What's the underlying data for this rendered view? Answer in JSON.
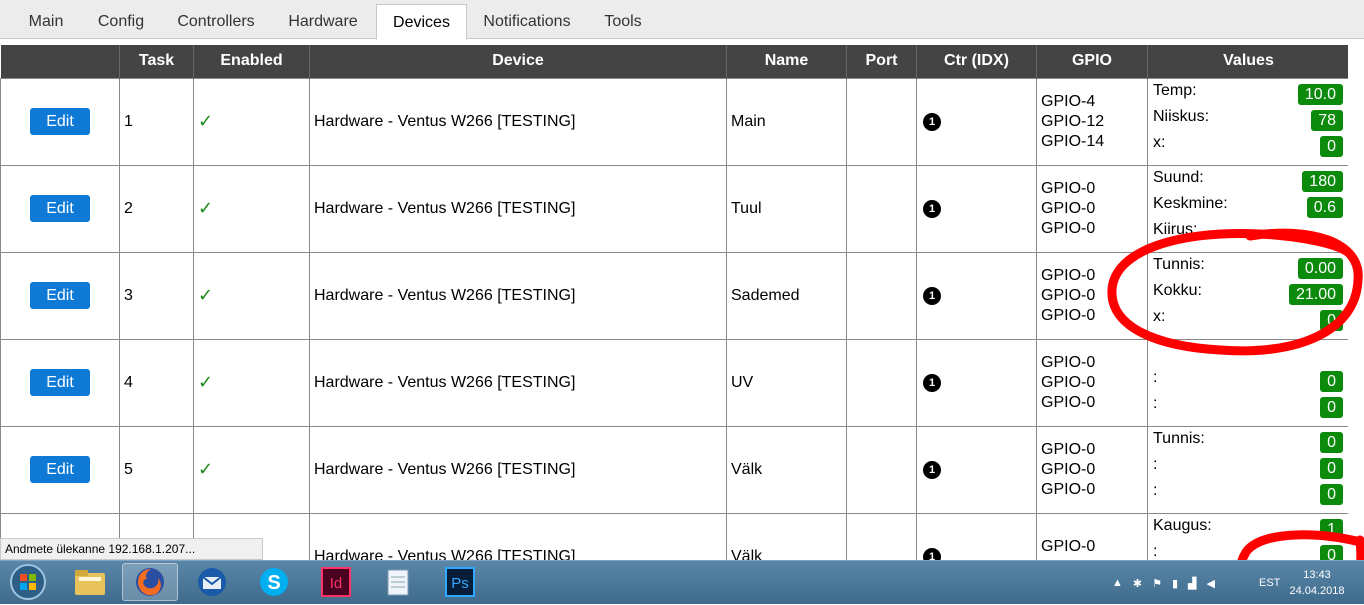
{
  "tabs": [
    {
      "label": "Main",
      "active": false
    },
    {
      "label": "Config",
      "active": false
    },
    {
      "label": "Controllers",
      "active": false
    },
    {
      "label": "Hardware",
      "active": false
    },
    {
      "label": "Devices",
      "active": true
    },
    {
      "label": "Notifications",
      "active": false
    },
    {
      "label": "Tools",
      "active": false
    }
  ],
  "table": {
    "headers": [
      "",
      "Task",
      "Enabled",
      "Device",
      "Name",
      "Port",
      "Ctr (IDX)",
      "GPIO",
      "Values"
    ],
    "edit_label": "Edit",
    "check_glyph": "✓",
    "ctr_glyph": "1",
    "rows": [
      {
        "task": "1",
        "device": "Hardware - Ventus W266 [TESTING]",
        "name": "Main",
        "port": "",
        "gpio": [
          "GPIO-4",
          "GPIO-12",
          "GPIO-14"
        ],
        "values": [
          {
            "label": "Temp:",
            "value": "10.0"
          },
          {
            "label": "Niiskus:",
            "value": "78"
          },
          {
            "label": "x:",
            "value": "0"
          }
        ]
      },
      {
        "task": "2",
        "device": "Hardware - Ventus W266 [TESTING]",
        "name": "Tuul",
        "port": "",
        "gpio": [
          "GPIO-0",
          "GPIO-0",
          "GPIO-0"
        ],
        "values": [
          {
            "label": "Suund:",
            "value": "180"
          },
          {
            "label": "Keskmine:",
            "value": "0.6"
          },
          {
            "label": "Kiirus:",
            "value": ""
          }
        ]
      },
      {
        "task": "3",
        "device": "Hardware - Ventus W266 [TESTING]",
        "name": "Sademed",
        "port": "",
        "gpio": [
          "GPIO-0",
          "GPIO-0",
          "GPIO-0"
        ],
        "values": [
          {
            "label": "Tunnis:",
            "value": "0.00"
          },
          {
            "label": "Kokku:",
            "value": "21.00"
          },
          {
            "label": "x:",
            "value": "0"
          }
        ]
      },
      {
        "task": "4",
        "device": "Hardware - Ventus W266 [TESTING]",
        "name": "UV",
        "port": "",
        "gpio": [
          "GPIO-0",
          "GPIO-0",
          "GPIO-0"
        ],
        "values": [
          {
            "label": "",
            "value": ""
          },
          {
            "label": ":",
            "value": "0"
          },
          {
            "label": ":",
            "value": "0"
          }
        ]
      },
      {
        "task": "5",
        "device": "Hardware - Ventus W266 [TESTING]",
        "name": "Välk",
        "port": "",
        "gpio": [
          "GPIO-0",
          "GPIO-0",
          "GPIO-0"
        ],
        "values": [
          {
            "label": "Tunnis:",
            "value": "0"
          },
          {
            "label": ":",
            "value": "0"
          },
          {
            "label": ":",
            "value": "0"
          }
        ]
      },
      {
        "task": "",
        "device": "Hardware - Ventus W266 [TESTING]",
        "name": "Välk",
        "port": "",
        "gpio": [
          "GPIO-0",
          "GPIO-0",
          ""
        ],
        "values": [
          {
            "label": "Kaugus:",
            "value": "1"
          },
          {
            "label": ":",
            "value": "0"
          },
          {
            "label": "",
            "value": ""
          }
        ]
      }
    ]
  },
  "status_bar": {
    "text": "Andmete ülekanne 192.168.1.207..."
  },
  "taskbar": {
    "apps": [
      {
        "name": "start-orb-icon",
        "active": false
      },
      {
        "name": "file-explorer-icon",
        "active": false
      },
      {
        "name": "firefox-icon",
        "active": true
      },
      {
        "name": "thunderbird-icon",
        "active": false
      },
      {
        "name": "skype-icon",
        "active": false
      },
      {
        "name": "indesign-icon",
        "active": false
      },
      {
        "name": "notepad-icon",
        "active": false
      },
      {
        "name": "photoshop-icon",
        "active": false
      }
    ],
    "indesign_label": "Id",
    "photoshop_label": "Ps",
    "skype_label": "S",
    "tray_language": "EST",
    "clock_time": "13:43",
    "clock_date": "24.04.2018"
  },
  "colors": {
    "header_bg": "#444444",
    "edit_button": "#0e7ad6",
    "value_badge": "#0b8a0b",
    "check": "#1a8a1a",
    "annotation_red": "#ff0000"
  }
}
